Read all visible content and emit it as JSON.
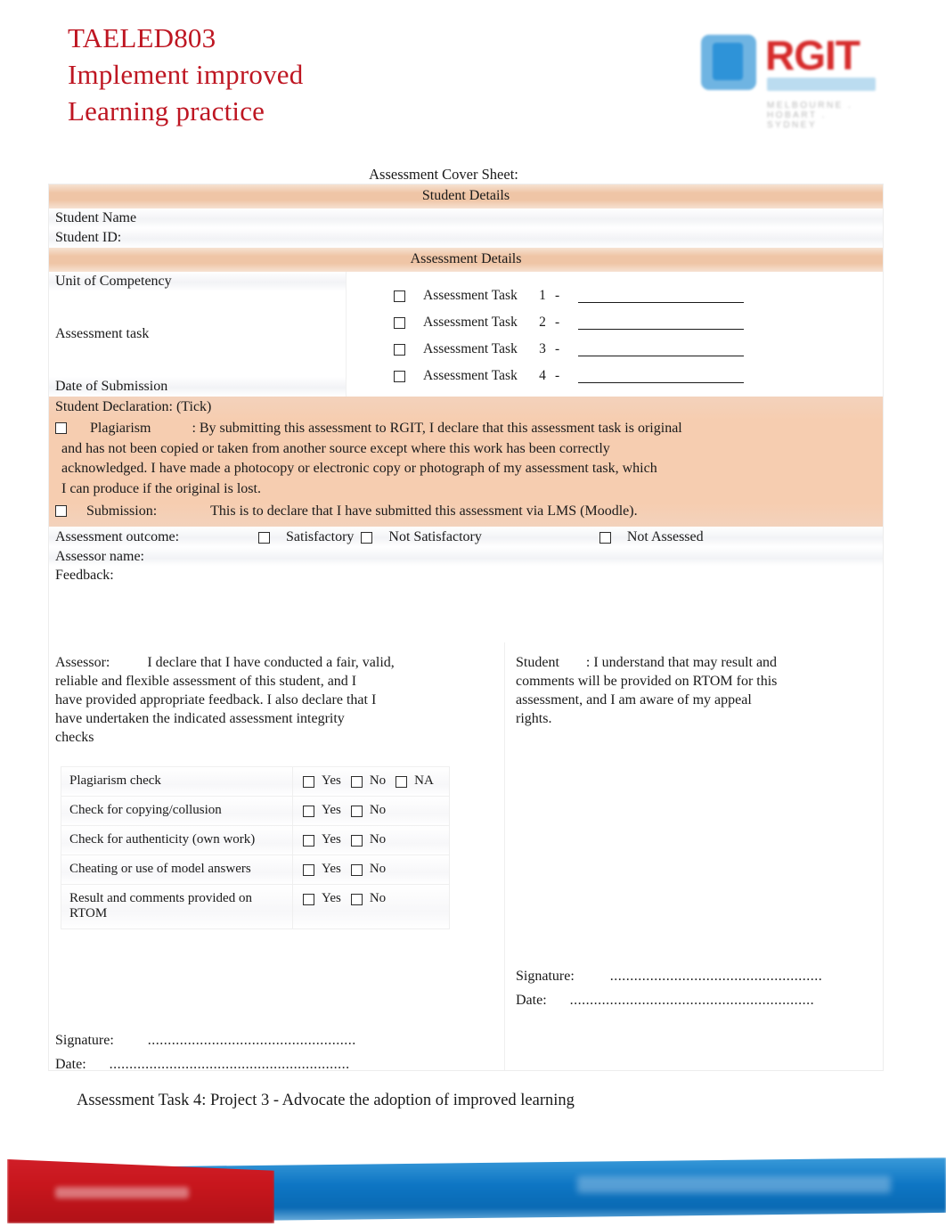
{
  "header": {
    "title_lines": [
      "TAELED803",
      "Implement improved",
      "Learning practice"
    ],
    "title_color": "#BE1622",
    "logo": {
      "name": "RGIT",
      "tagline": "MELBOURNE  .  HOBART  .  SYDNEY",
      "blue": "#2E93D8",
      "red": "#D62B2B"
    }
  },
  "cover": {
    "sheet_title": "Assessment Cover Sheet:",
    "student_details_band": "Student Details",
    "student_name_label": "Student Name",
    "student_id_label": "Student ID:",
    "assessment_details_band": "Assessment Details",
    "unit_label": "Unit of Competency",
    "assessment_task_label": "Assessment task",
    "date_of_submission_label": "Date of Submission",
    "tasks": [
      {
        "label": "Assessment Task",
        "number": "1",
        "dash": "-"
      },
      {
        "label": "Assessment Task",
        "number": "2",
        "dash": "-"
      },
      {
        "label": "Assessment Task",
        "number": "3",
        "dash": "-"
      },
      {
        "label": "Assessment Task",
        "number": "4",
        "dash": "-"
      }
    ]
  },
  "declaration": {
    "heading": "Student Declaration: (Tick)",
    "plagiarism_label": "Plagiarism",
    "plagiarism_text": ": By submitting this assessment to RGIT, I declare that this assessment task is original",
    "plagiarism_line2": "and has not been copied or taken from another source except where this work has been correctly",
    "plagiarism_line3": "acknowledged. I have made a photocopy or electronic copy or photograph of my assessment task, which",
    "plagiarism_line4": "I can produce if the original is lost.",
    "submission_label": "Submission:",
    "submission_text": "This is to declare that I have submitted this assessment via LMS (Moodle).",
    "band_color": "#F6CDB0"
  },
  "outcome": {
    "label": "Assessment outcome:",
    "options": [
      "Satisfactory",
      "Not Satisfactory",
      "Not Assessed"
    ],
    "assessor_name_label": "Assessor name:",
    "feedback_label": "Feedback:"
  },
  "assessor_panel": {
    "role": "Assessor:",
    "line1": "I declare that I have conducted a fair, valid,",
    "line2": "reliable and flexible assessment of this student, and I",
    "line3": "have provided appropriate feedback. I also declare that I",
    "line4": "have undertaken the indicated assessment integrity",
    "line5": "checks",
    "signature_label": "Signature:",
    "signature_dots": "....................................................",
    "date_label": "Date:",
    "date_dots": "............................................................"
  },
  "student_panel": {
    "role": "Student",
    "line1": ": I understand that may result and",
    "line2": "comments will be provided on RTOM for this",
    "line3": "assessment, and I am aware of my appeal",
    "line4": "rights.",
    "signature_label": "Signature:",
    "signature_dots": ".....................................................",
    "date_label": "Date:",
    "date_dots": "............................................................."
  },
  "integrity_checks": {
    "rows": [
      {
        "check": "Plagiarism check",
        "options": [
          "Yes",
          "No",
          "NA"
        ]
      },
      {
        "check": "Check for copying/collusion",
        "options": [
          "Yes",
          "No"
        ]
      },
      {
        "check": "Check for authenticity (own work)",
        "options": [
          "Yes",
          "No"
        ]
      },
      {
        "check": "Cheating or use of model answers",
        "options": [
          "Yes",
          "No"
        ]
      },
      {
        "check": "Result and comments provided on RTOM",
        "options": [
          "Yes",
          "No"
        ]
      }
    ]
  },
  "bottom": {
    "task_title": "Assessment Task 4: Project 3 - Advocate the adoption of improved learning"
  },
  "footer": {
    "red": "#C8161D",
    "blue": "#0E76C4"
  }
}
